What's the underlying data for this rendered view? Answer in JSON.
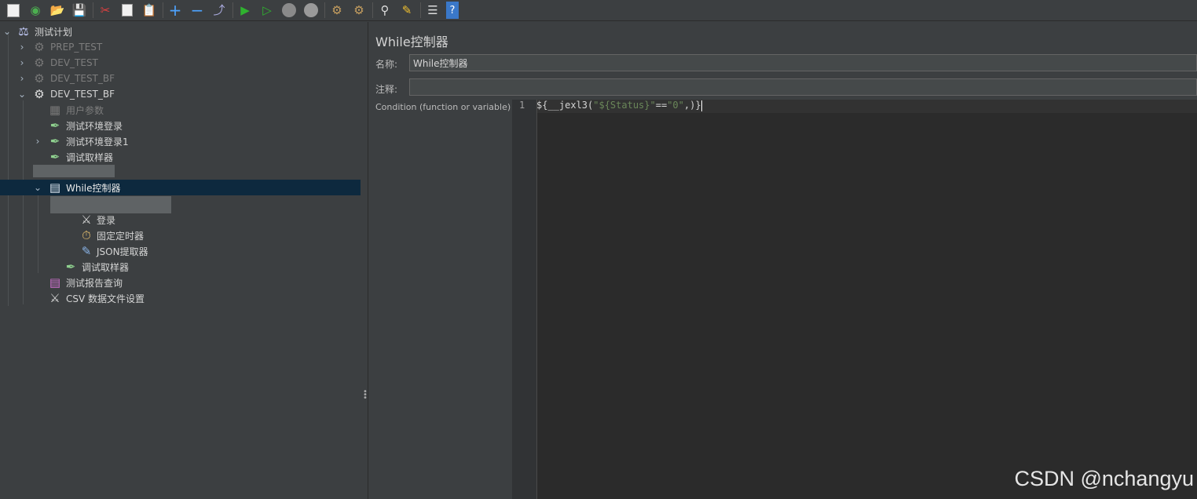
{
  "toolbar": {
    "buttons": [
      {
        "icon": "new-icon"
      },
      {
        "icon": "templates-icon"
      },
      {
        "icon": "open-icon"
      },
      {
        "icon": "save-icon"
      },
      {
        "icon": "cut-icon"
      },
      {
        "icon": "copy-icon"
      },
      {
        "icon": "paste-icon"
      },
      {
        "icon": "expand-icon"
      },
      {
        "icon": "collapse-icon"
      },
      {
        "icon": "toggle-icon"
      },
      {
        "icon": "start-icon"
      },
      {
        "icon": "start-no-pauses-icon"
      },
      {
        "icon": "stop-icon"
      },
      {
        "icon": "shutdown-icon"
      },
      {
        "icon": "clear-icon"
      },
      {
        "icon": "clear-all-icon"
      },
      {
        "icon": "search-icon"
      },
      {
        "icon": "reset-search-icon"
      },
      {
        "icon": "function-helper-icon"
      },
      {
        "icon": "help-icon"
      }
    ]
  },
  "tree": {
    "root": "测试计划",
    "items": [
      {
        "label": "PREP_TEST",
        "icon": "gear-icon",
        "disabled": true
      },
      {
        "label": "DEV_TEST",
        "icon": "gear-icon",
        "disabled": true
      },
      {
        "label": "DEV_TEST_BF",
        "icon": "gear-icon",
        "disabled": true
      },
      {
        "label": "DEV_TEST_BF",
        "icon": "gear-icon",
        "disabled": false
      },
      {
        "label": "用户参数",
        "icon": "user-params-icon",
        "disabled": true
      },
      {
        "label": "测试环境登录",
        "icon": "sampler-icon",
        "disabled": false
      },
      {
        "label": "测试环境登录1",
        "icon": "sampler-icon",
        "disabled": false
      },
      {
        "label": "调试取样器",
        "icon": "sampler-icon",
        "disabled": false
      },
      {
        "label": "While控制器",
        "icon": "while-controller-icon",
        "disabled": false,
        "selected": true
      },
      {
        "label": "登录",
        "icon": "login-tool-icon",
        "disabled": false
      },
      {
        "label": "固定定时器",
        "icon": "timer-icon",
        "disabled": false
      },
      {
        "label": "JSON提取器",
        "icon": "json-extractor-icon",
        "disabled": false
      },
      {
        "label": "调试取样器",
        "icon": "sampler-icon",
        "disabled": false
      },
      {
        "label": "测试报告查询",
        "icon": "report-icon",
        "disabled": false
      },
      {
        "label": "CSV 数据文件设置",
        "icon": "csv-config-icon",
        "disabled": false
      }
    ]
  },
  "panel": {
    "title": "While控制器",
    "name_label": "名称:",
    "name_value": "While控制器",
    "comment_label": "注释:",
    "comment_value": "",
    "condition_label": "Condition (function or variable)",
    "line_number": "1",
    "code": {
      "p1": "${__jexl3(",
      "s1": "\"${Status}\"",
      "p2": "==",
      "s2": "\"0\"",
      "p3": ",)}"
    }
  },
  "watermark": "CSDN @nchangyu",
  "colors": {
    "background": "#3c3f41",
    "selection": "#0d293e",
    "editor": "#2b2b2b",
    "string": "#6a8759"
  }
}
